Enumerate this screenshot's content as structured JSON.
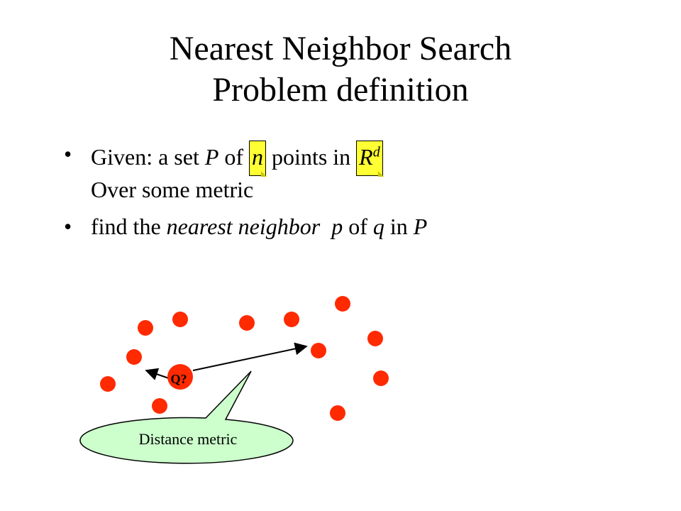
{
  "slide": {
    "title_line1": "Nearest Neighbor Search",
    "title_line2": "Problem definition",
    "bullet_marker": "•",
    "bullet1": {
      "part1": "Given: a set ",
      "var_P": "P",
      "part2": " of ",
      "var_n": "n",
      "part3": " points in ",
      "var_R": "R",
      "sup_d": "d",
      "line2": "Over some metric"
    },
    "bullet2": {
      "part1": "find the ",
      "phrase": "nearest neighbor  p",
      "part2": " of ",
      "var_q": "q",
      "part3": " in ",
      "var_P": "P"
    }
  },
  "diagram": {
    "query_label": "Q?",
    "callout_label": "Distance metric",
    "point_color": "#ff2a00",
    "callout_fill": "#ccffcc",
    "highlight_color": "#ffff33"
  }
}
